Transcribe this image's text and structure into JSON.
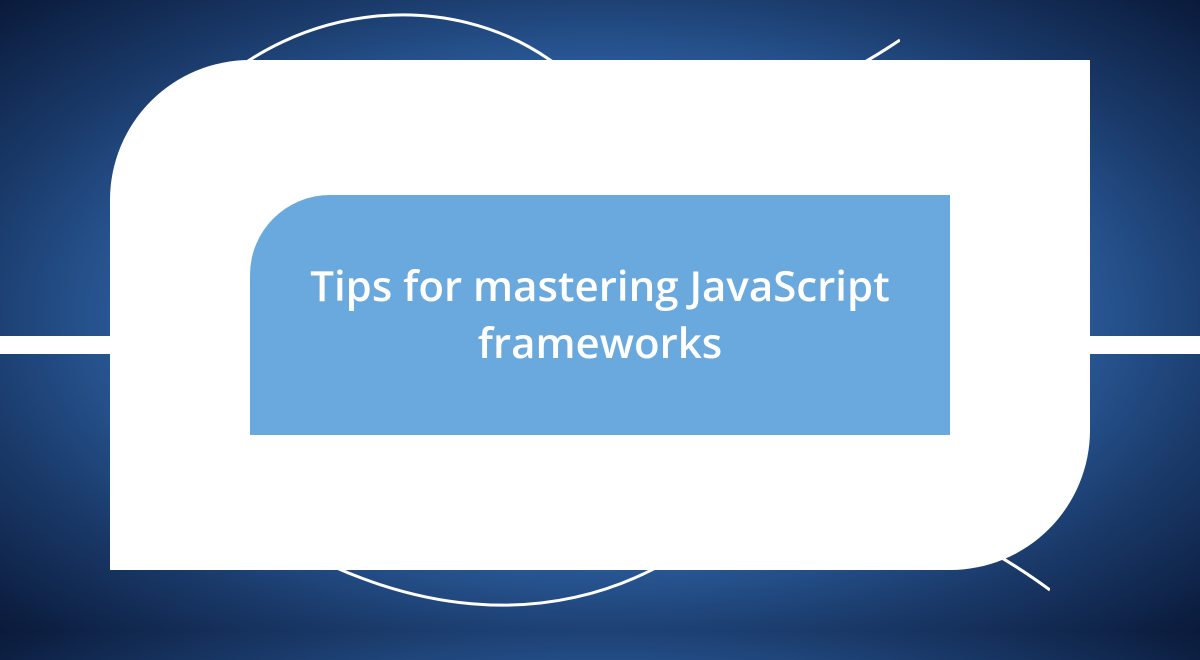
{
  "card": {
    "title": "Tips for mastering JavaScript frameworks"
  },
  "colors": {
    "background_center": "#5a9bd8",
    "background_edge": "#0a1a3a",
    "frame": "#ffffff",
    "panel": "#6aa9de",
    "text": "#ffffff"
  }
}
